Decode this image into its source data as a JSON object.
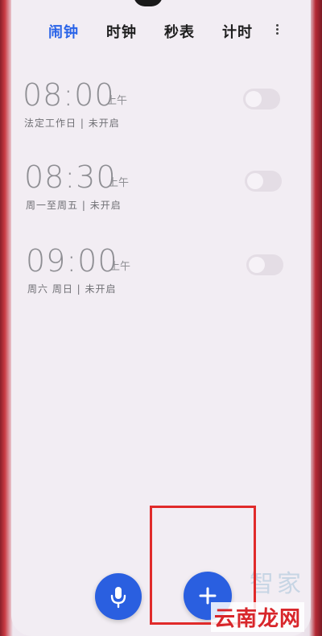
{
  "tabs": [
    {
      "label": "闹钟",
      "active": true
    },
    {
      "label": "时钟",
      "active": false
    },
    {
      "label": "秒表",
      "active": false
    },
    {
      "label": "计时",
      "active": false
    }
  ],
  "alarms": [
    {
      "time": "08:00",
      "ampm": "上午",
      "repeat": "法定工作日",
      "status": "未开启",
      "enabled": false
    },
    {
      "time": "08:30",
      "ampm": "上午",
      "repeat": "周一至周五",
      "status": "未开启",
      "enabled": false
    },
    {
      "time": "09:00",
      "ampm": "上午",
      "repeat": "周六 周日",
      "status": "未开启",
      "enabled": false
    }
  ],
  "colors": {
    "accent": "#2a64e8",
    "fab": "#2a5fe0",
    "highlight": "#e02a2a"
  },
  "icons": {
    "more": "more-vertical-icon",
    "mic": "microphone-icon",
    "add": "plus-icon"
  },
  "watermark": {
    "text": "云南龙网",
    "ghost": "智家"
  }
}
